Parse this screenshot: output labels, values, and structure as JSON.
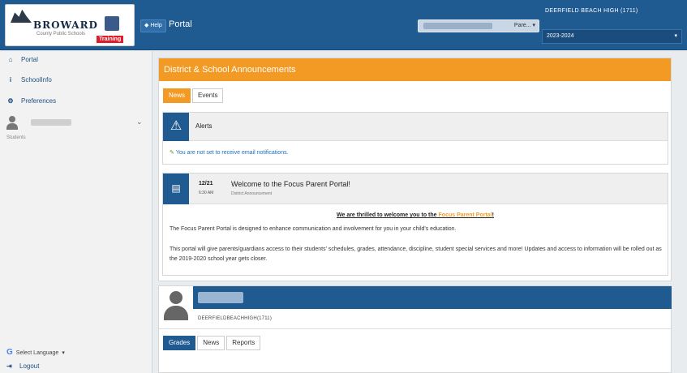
{
  "header": {
    "logo_text": "BROWARD",
    "logo_sub": "County Public Schools",
    "training_badge": "Training",
    "help_label": "◆ Help",
    "title": "Portal",
    "search_select": "Pare... ▾",
    "school_name": "DEERFIELD BEACH HIGH (1711)",
    "year": "2023-2024",
    "year_caret": "▾"
  },
  "sidebar": {
    "items": [
      {
        "icon": "⌂",
        "label": "Portal"
      },
      {
        "icon": "i",
        "label": "SchoolInfo"
      },
      {
        "icon": "⚙",
        "label": "Preferences"
      }
    ],
    "user_chevron": "⌄",
    "user_sub": "Students",
    "language_g": "G",
    "language_label": "Select Language",
    "language_caret": "▾",
    "logout_icon": "⇥",
    "logout_label": "Logout"
  },
  "announcements": {
    "title": "District & School Announcements",
    "tabs": [
      "News",
      "Events"
    ],
    "alerts": {
      "icon": "⚠",
      "title": "Alerts",
      "link_icon": "✎",
      "link": "You are not set to receive email notifications."
    },
    "welcome": {
      "icon": "▤",
      "date": "12/21",
      "time": "6:30 AM",
      "title": "Welcome to the Focus Parent Portal!",
      "subtitle": "District Announcement",
      "banner_prefix": "We are thrilled to welcome you to the ",
      "banner_link": "Focus Parent Portal",
      "banner_suffix": "!",
      "p1": "The Focus Parent Portal is designed to enhance communication and involvement for you in your child's education.",
      "p2": "This portal will give parents/guardians access to their students' schedules, grades, attendance, discipline, student special services and more! Updates and access to information will be rolled out as the 2019-2020 school year gets closer."
    }
  },
  "student": {
    "id_line": "DEERFIELDBEACHHIGH(1711)",
    "tabs": [
      "Grades",
      "News",
      "Reports"
    ]
  },
  "colors": {
    "header_blue": "#1f5a91",
    "accent_orange": "#f39a24",
    "training_red": "#e21b2b"
  }
}
